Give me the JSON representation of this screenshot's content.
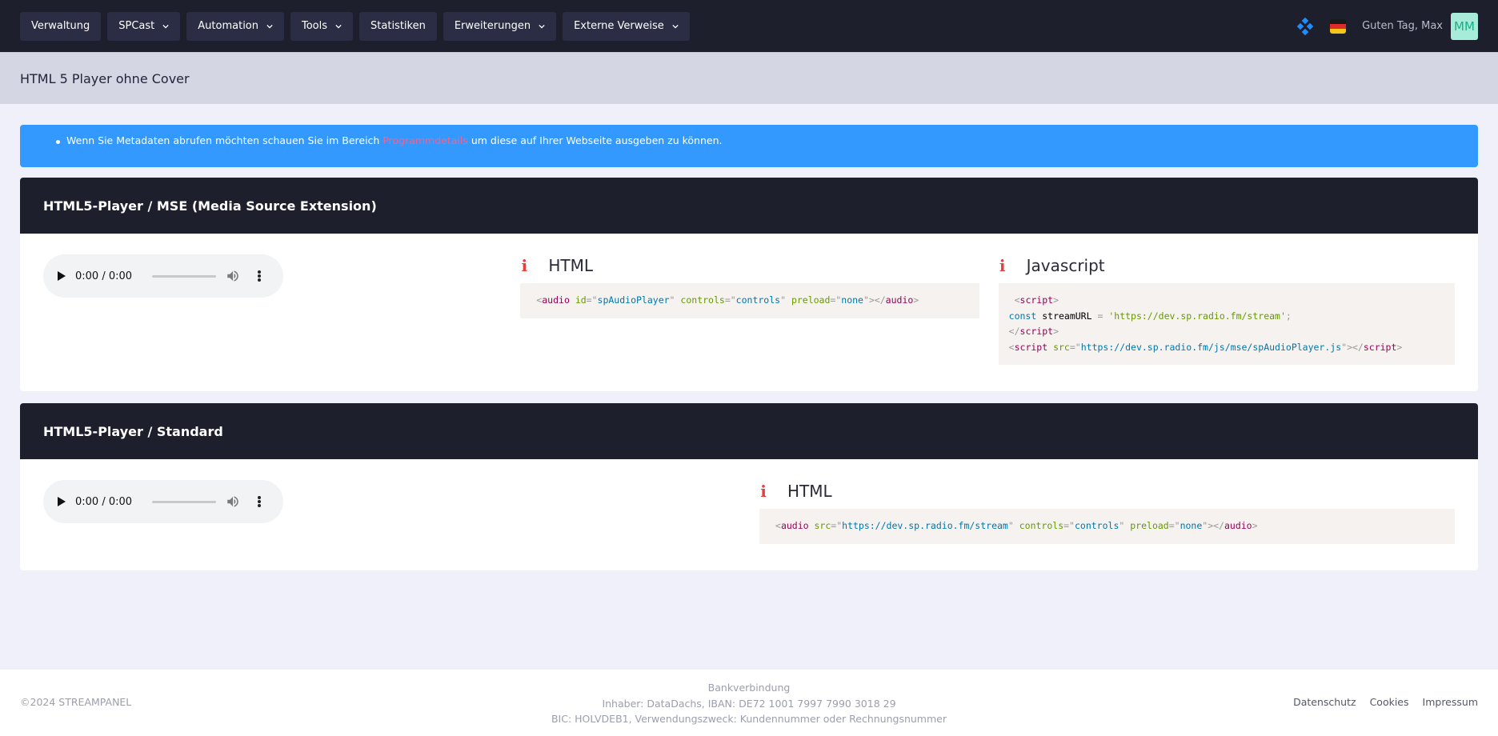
{
  "nav": {
    "items": [
      {
        "label": "Verwaltung",
        "dropdown": false
      },
      {
        "label": "SPCast",
        "dropdown": true
      },
      {
        "label": "Automation",
        "dropdown": true
      },
      {
        "label": "Tools",
        "dropdown": true
      },
      {
        "label": "Statistiken",
        "dropdown": false
      },
      {
        "label": "Erweiterungen",
        "dropdown": true
      },
      {
        "label": "Externe Verweise",
        "dropdown": true
      }
    ],
    "greeting": "Guten Tag, Max",
    "avatar_initials": "MM"
  },
  "page": {
    "title": "HTML 5 Player ohne Cover"
  },
  "alert": {
    "text_before": "Wenn Sie Metadaten abrufen möchten schauen Sie im Bereich ",
    "link": "Programmdetails",
    "text_after": " um diese auf Ihrer Webseite ausgeben zu können."
  },
  "cards": [
    {
      "title": "HTML5-Player / MSE (Media Source Extension)",
      "player": {
        "time": "0:00 / 0:00"
      },
      "html_heading": "HTML",
      "js_heading": "Javascript"
    },
    {
      "title": "HTML5-Player / Standard",
      "player": {
        "time": "0:00 / 0:00"
      },
      "html_heading": "HTML"
    }
  ],
  "code": {
    "mse_html": {
      "tag": "audio",
      "id_attr": "id",
      "id_val": "spAudioPlayer",
      "controls_attr": "controls",
      "controls_val": "controls",
      "preload_attr": "preload",
      "preload_val": "none"
    },
    "mse_js": {
      "script_tag": "script",
      "const_kw": "const",
      "var_name": "streamURL",
      "op": "=",
      "stream_url": "'https://dev.sp.radio.fm/stream'",
      "src_attr": "src",
      "src_val": "https://dev.sp.radio.fm/js/mse/spAudioPlayer.js"
    },
    "std_html": {
      "tag": "audio",
      "src_attr": "src",
      "src_val": "https://dev.sp.radio.fm/stream",
      "controls_attr": "controls",
      "controls_val": "controls",
      "preload_attr": "preload",
      "preload_val": "none"
    }
  },
  "footer": {
    "copyright": "©2024 STREAMPANEL",
    "bank_title": "Bankverbindung",
    "bank_line1": "Inhaber: DataDachs, IBAN: DE72 1001 7997 7990 3018 29",
    "bank_line2": "BIC: HOLVDEB1, Verwendungszweck: Kundennummer oder Rechnungsnummer",
    "links": [
      "Datenschutz",
      "Cookies",
      "Impressum"
    ]
  },
  "colors": {
    "navbar": "#1e1f2d",
    "alert": "#3399ff",
    "link": "#ff5e84",
    "info_icon": "#e5403e",
    "avatar_bg": "#a7ecd8"
  }
}
